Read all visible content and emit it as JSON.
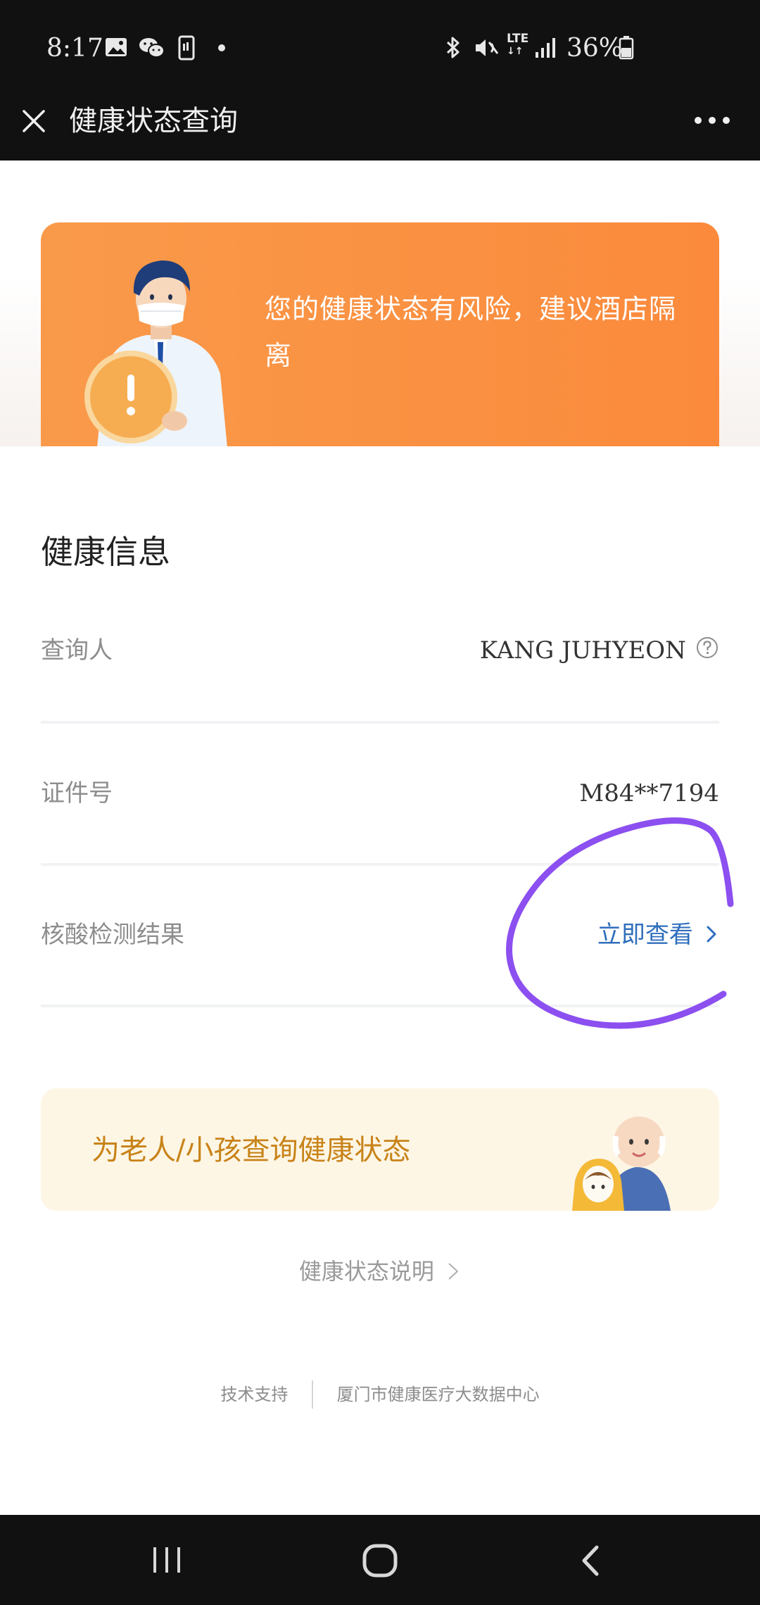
{
  "status_bar": {
    "time": "8:17",
    "network": "LTE",
    "battery": "36%"
  },
  "title_bar": {
    "title": "健康状态查询"
  },
  "banner": {
    "message": "您的健康状态有风险，建议酒店隔离",
    "accent": "#fb8a3c"
  },
  "health_info": {
    "title": "健康信息",
    "rows": [
      {
        "label": "查询人",
        "value": "KANG JUHYEON"
      },
      {
        "label": "证件号",
        "value": "M84**7194"
      },
      {
        "label": "核酸检测结果",
        "value": "立即查看"
      }
    ]
  },
  "family_card": {
    "label": "为老人/小孩查询健康状态"
  },
  "explain_link": {
    "label": "健康状态说明"
  },
  "footer": {
    "left": "技术支持",
    "right": "厦门市健康医疗大数据中心"
  },
  "colors": {
    "link": "#2f6ebd",
    "annotation": "#8c4ff0",
    "card_text": "#c88319"
  }
}
